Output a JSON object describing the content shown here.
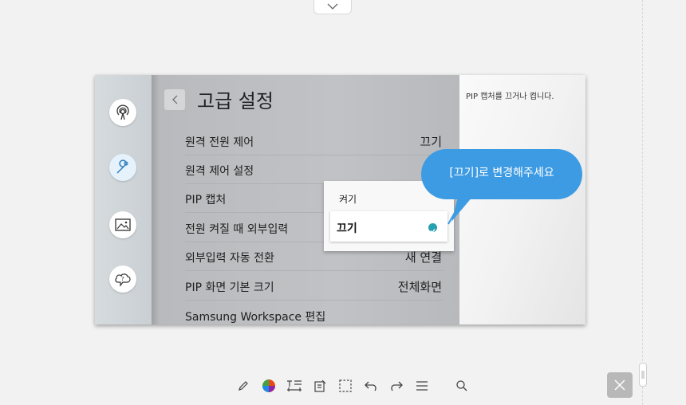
{
  "screen": {
    "title": "고급 설정",
    "settings": [
      {
        "label": "원격 전원 제어",
        "value": "끄기"
      },
      {
        "label": "원격 제어 설정",
        "value": ""
      },
      {
        "label": "PIP 캡처",
        "value": ""
      },
      {
        "label": "전원 켜질 때 외부입력",
        "value": ""
      },
      {
        "label": "외부입력 자동 전환",
        "value": "새 연결"
      },
      {
        "label": "PIP 화면 기본 크기",
        "value": "전체화면"
      },
      {
        "label": "Samsung Workspace 편집",
        "value": ""
      }
    ],
    "popup_options": [
      {
        "label": "켜기",
        "selected": false
      },
      {
        "label": "끄기",
        "selected": true
      }
    ],
    "help_text": "PIP 캡처를 끄거나 켭니다.",
    "sidebar_icons": [
      "broadcast-icon",
      "wrench-icon",
      "picture-icon",
      "support-icon"
    ]
  },
  "callout_text": "[끄기]로 변경해주세요",
  "toolbar_icons": [
    "pen-icon",
    "color-picker-icon",
    "text-icon",
    "note-icon",
    "select-icon",
    "undo-icon",
    "redo-icon",
    "menu-icon",
    "search-icon"
  ],
  "colors": {
    "callout": "#3d9be3",
    "check": "#28a0b0",
    "active_sidebar": "#e6f2fb"
  }
}
